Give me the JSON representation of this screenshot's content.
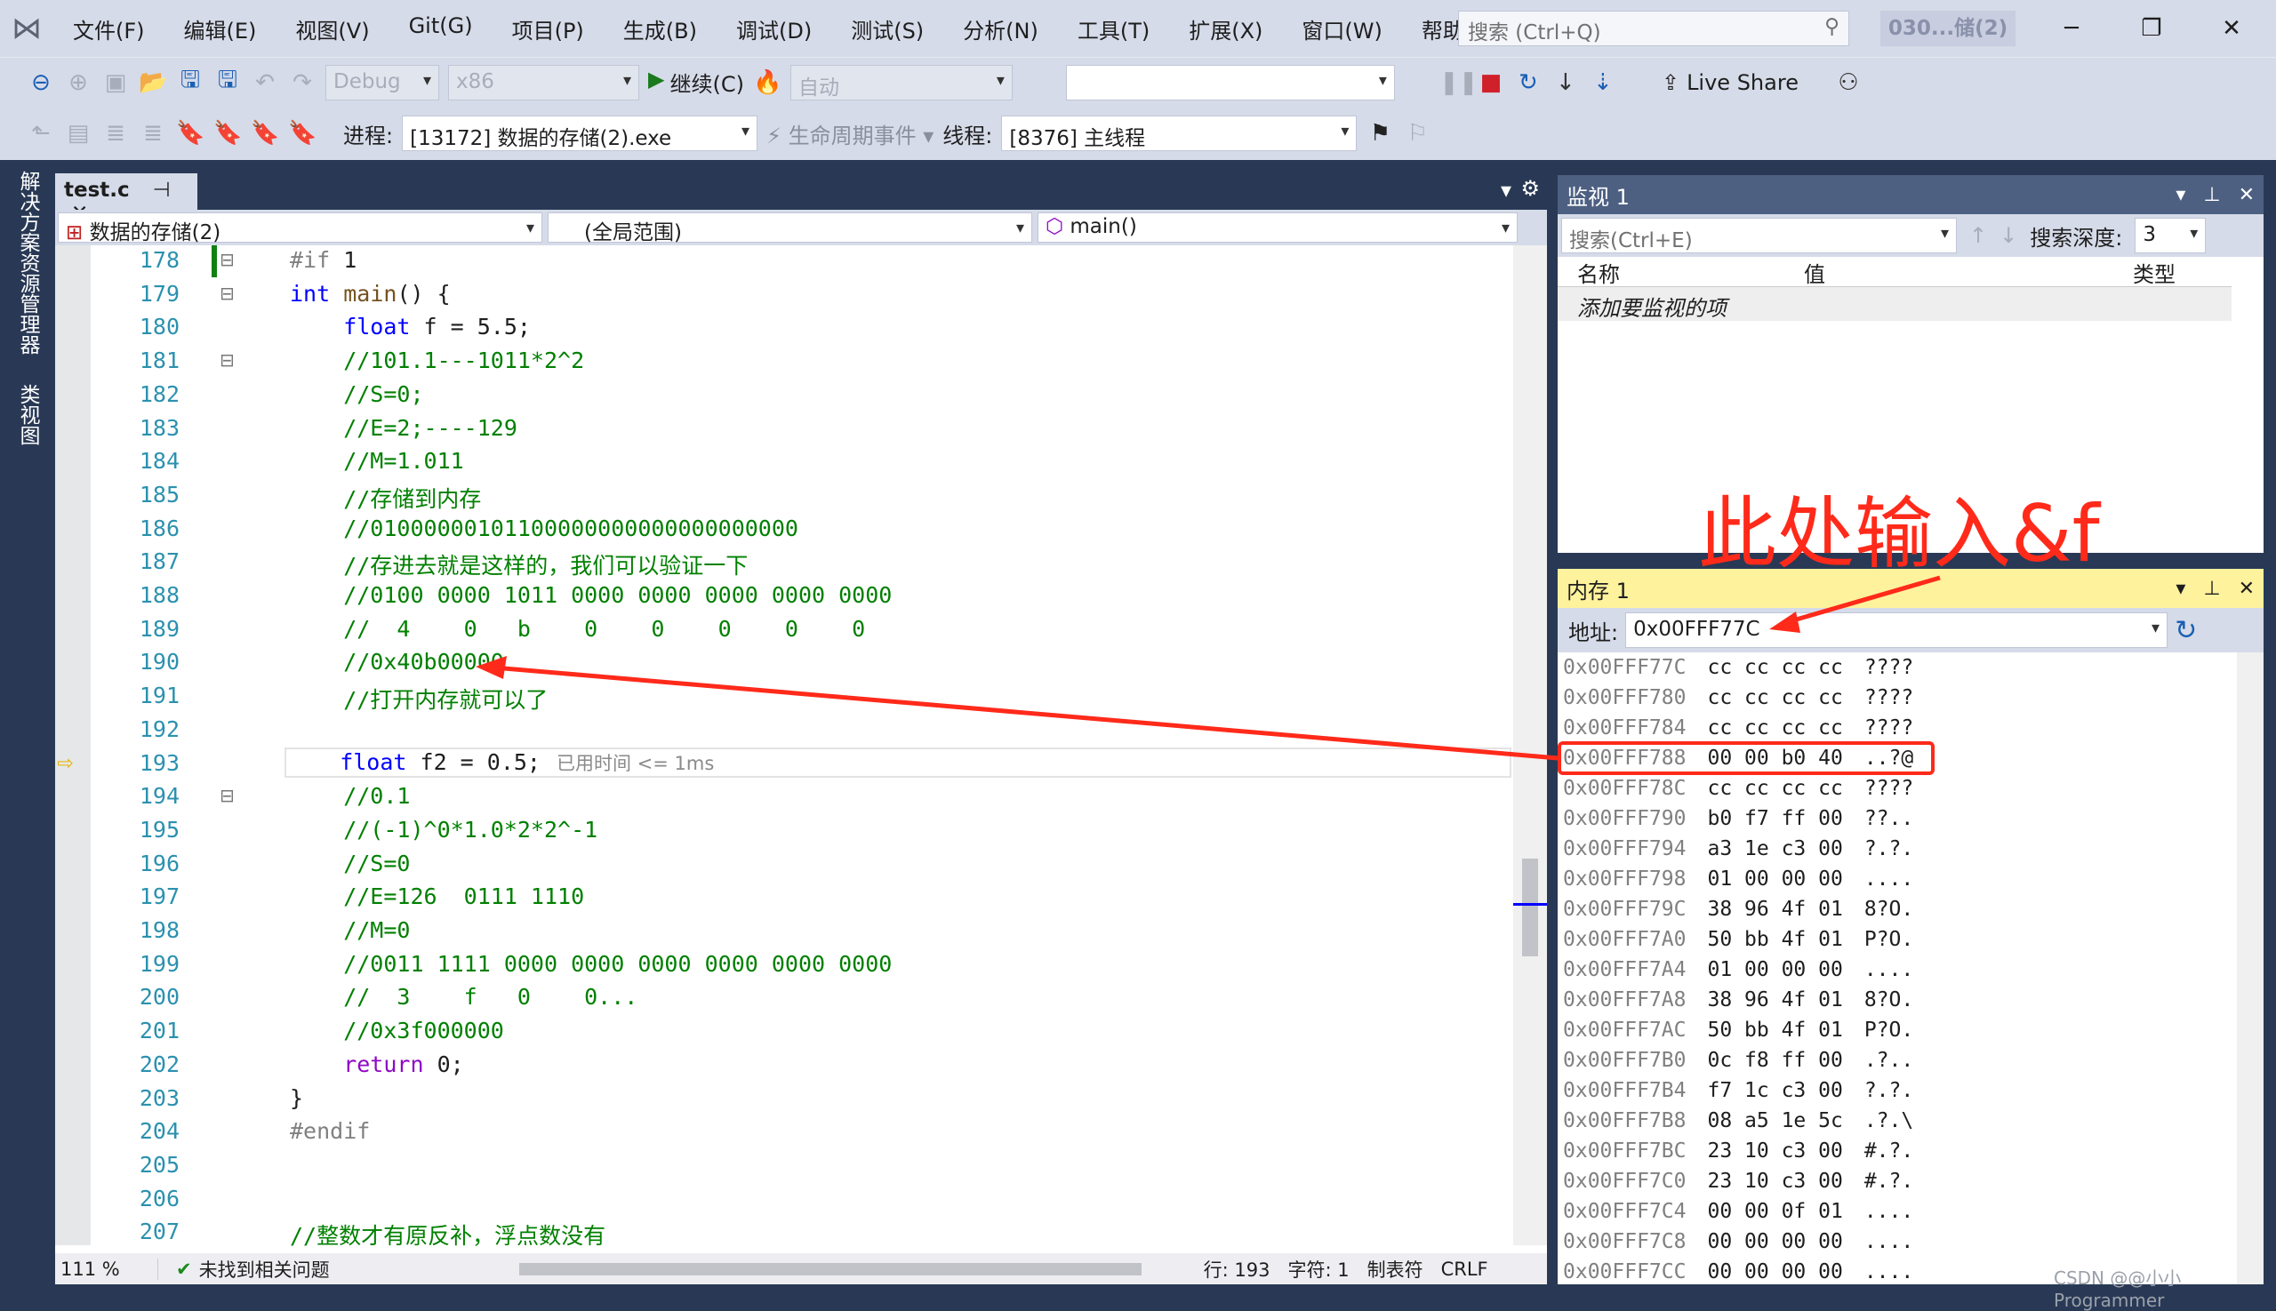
{
  "menu": [
    "文件(F)",
    "编辑(E)",
    "视图(V)",
    "Git(G)",
    "项目(P)",
    "生成(B)",
    "调试(D)",
    "测试(S)",
    "分析(N)",
    "工具(T)",
    "扩展(X)",
    "窗口(W)",
    "帮助(H)"
  ],
  "search_placeholder": "搜索 (Ctrl+Q)",
  "window_title": "030...储(2)",
  "toolbar": {
    "config": "Debug",
    "platform": "x86",
    "continue": "继续(C)",
    "auto": "自动",
    "live_share": "Live Share",
    "process_label": "进程:",
    "process": "[13172] 数据的存储(2).exe",
    "lifecycle": "生命周期事件",
    "thread_label": "线程:",
    "thread": "[8376] 主线程"
  },
  "side_tabs": [
    "解决方案资源管理器",
    "类视图"
  ],
  "editor": {
    "tab": "test.c",
    "project": "数据的存储(2)",
    "scope": "(全局范围)",
    "function": "main()",
    "current_line": 193,
    "lines": [
      {
        "n": 178,
        "t": [
          [
            "#if ",
            "pp"
          ],
          [
            "1",
            "nm"
          ]
        ]
      },
      {
        "n": 179,
        "t": [
          [
            "int ",
            "kw"
          ],
          [
            "main",
            "fn"
          ],
          [
            "() {",
            "nm"
          ]
        ]
      },
      {
        "n": 180,
        "t": [
          [
            "    float ",
            "kw"
          ],
          [
            "f = 5.5;",
            "nm"
          ]
        ]
      },
      {
        "n": 181,
        "t": [
          [
            "    //101.1---1011*2^2",
            "cm"
          ]
        ]
      },
      {
        "n": 182,
        "t": [
          [
            "    //S=0;",
            "cm"
          ]
        ]
      },
      {
        "n": 183,
        "t": [
          [
            "    //E=2;----129",
            "cm"
          ]
        ]
      },
      {
        "n": 184,
        "t": [
          [
            "    //M=1.011",
            "cm"
          ]
        ]
      },
      {
        "n": 185,
        "t": [
          [
            "    //存储到内存",
            "cm"
          ]
        ]
      },
      {
        "n": 186,
        "t": [
          [
            "    //01000000101100000000000000000000",
            "cm"
          ]
        ]
      },
      {
        "n": 187,
        "t": [
          [
            "    //存进去就是这样的，我们可以验证一下",
            "cm"
          ]
        ]
      },
      {
        "n": 188,
        "t": [
          [
            "    //0100 0000 1011 0000 0000 0000 0000 0000",
            "cm"
          ]
        ]
      },
      {
        "n": 189,
        "t": [
          [
            "    //  4    0   b    0    0    0    0    0",
            "cm"
          ]
        ]
      },
      {
        "n": 190,
        "t": [
          [
            "    //0x40b00000",
            "cm"
          ]
        ]
      },
      {
        "n": 191,
        "t": [
          [
            "    //打开内存就可以了",
            "cm"
          ]
        ]
      },
      {
        "n": 192,
        "t": []
      },
      {
        "n": 193,
        "t": [
          [
            "    float ",
            "kw"
          ],
          [
            "f2 = 0.5;",
            "nm"
          ]
        ],
        "hint": "已用时间 <= 1ms"
      },
      {
        "n": 194,
        "t": [
          [
            "    //0.1",
            "cm"
          ]
        ]
      },
      {
        "n": 195,
        "t": [
          [
            "    //(-1)^0*1.0*2*2^-1",
            "cm"
          ]
        ]
      },
      {
        "n": 196,
        "t": [
          [
            "    //S=0",
            "cm"
          ]
        ]
      },
      {
        "n": 197,
        "t": [
          [
            "    //E=126  0111 1110",
            "cm"
          ]
        ]
      },
      {
        "n": 198,
        "t": [
          [
            "    //M=0",
            "cm"
          ]
        ]
      },
      {
        "n": 199,
        "t": [
          [
            "    //0011 1111 0000 0000 0000 0000 0000 0000",
            "cm"
          ]
        ]
      },
      {
        "n": 200,
        "t": [
          [
            "    //  3    f   0    0...",
            "cm"
          ]
        ]
      },
      {
        "n": 201,
        "t": [
          [
            "    //0x3f000000",
            "cm"
          ]
        ]
      },
      {
        "n": 202,
        "t": [
          [
            "    return ",
            "rt"
          ],
          [
            "0;",
            "nm"
          ]
        ]
      },
      {
        "n": 203,
        "t": [
          [
            "}",
            "nm"
          ]
        ]
      },
      {
        "n": 204,
        "t": [
          [
            "#endif",
            "pp"
          ]
        ]
      },
      {
        "n": 205,
        "t": []
      },
      {
        "n": 206,
        "t": []
      },
      {
        "n": 207,
        "t": [
          [
            "//整数才有原反补，浮点数没有",
            "cm"
          ]
        ]
      }
    ]
  },
  "status": {
    "zoom": "111 %",
    "issues": "未找到相关问题",
    "line": "行: 193",
    "char": "字符: 1",
    "tabs": "制表符",
    "eol": "CRLF"
  },
  "watch": {
    "title": "监视 1",
    "search": "搜索(Ctrl+E)",
    "depth_label": "搜索深度:",
    "depth": "3",
    "cols": [
      "名称",
      "值",
      "类型"
    ],
    "add_item": "添加要监视的项"
  },
  "memory": {
    "title": "内存 1",
    "addr_label": "地址:",
    "address": "0x00FFF77C",
    "rows": [
      [
        "0x00FFF77C",
        "cc cc cc cc",
        "????"
      ],
      [
        "0x00FFF780",
        "cc cc cc cc",
        "????"
      ],
      [
        "0x00FFF784",
        "cc cc cc cc",
        "????"
      ],
      [
        "0x00FFF788",
        "00 00 b0 40",
        "..?@"
      ],
      [
        "0x00FFF78C",
        "cc cc cc cc",
        "????"
      ],
      [
        "0x00FFF790",
        "b0 f7 ff 00",
        "??.."
      ],
      [
        "0x00FFF794",
        "a3 1e c3 00",
        "?.?."
      ],
      [
        "0x00FFF798",
        "01 00 00 00",
        "...."
      ],
      [
        "0x00FFF79C",
        "38 96 4f 01",
        "8?O."
      ],
      [
        "0x00FFF7A0",
        "50 bb 4f 01",
        "P?O."
      ],
      [
        "0x00FFF7A4",
        "01 00 00 00",
        "...."
      ],
      [
        "0x00FFF7A8",
        "38 96 4f 01",
        "8?O."
      ],
      [
        "0x00FFF7AC",
        "50 bb 4f 01",
        "P?O."
      ],
      [
        "0x00FFF7B0",
        "0c f8 ff 00",
        ".?.."
      ],
      [
        "0x00FFF7B4",
        "f7 1c c3 00",
        "?.?."
      ],
      [
        "0x00FFF7B8",
        "08 a5 1e 5c",
        ".?.\\"
      ],
      [
        "0x00FFF7BC",
        "23 10 c3 00",
        "#.?."
      ],
      [
        "0x00FFF7C0",
        "23 10 c3 00",
        "#.?."
      ],
      [
        "0x00FFF7C4",
        "00 00 0f 01",
        "...."
      ],
      [
        "0x00FFF7C8",
        "00 00 00 00",
        "...."
      ],
      [
        "0x00FFF7CC",
        "00 00 00 00",
        "...."
      ]
    ]
  },
  "annotation": {
    "text": "此处输入&f",
    "color": "#ff2a1a"
  },
  "watermark": "CSDN @@小小Programmer"
}
